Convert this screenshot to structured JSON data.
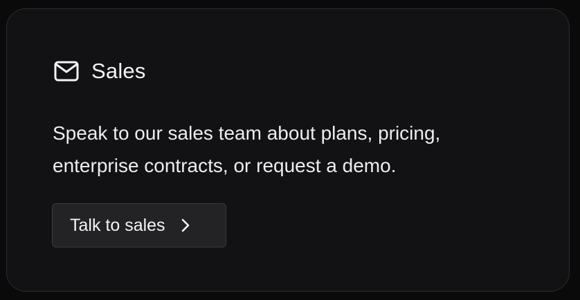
{
  "card": {
    "title": "Sales",
    "icon": "mail-icon",
    "description": "Speak to our sales team about plans, pricing, enterprise contracts, or request a demo.",
    "button": {
      "label": "Talk to sales",
      "icon": "chevron-right-icon"
    }
  },
  "colors": {
    "page_background": "#0a0a0b",
    "card_background": "#121214",
    "card_border": "#2c2c30",
    "button_background": "#232326",
    "text": "#f4f4f5"
  }
}
